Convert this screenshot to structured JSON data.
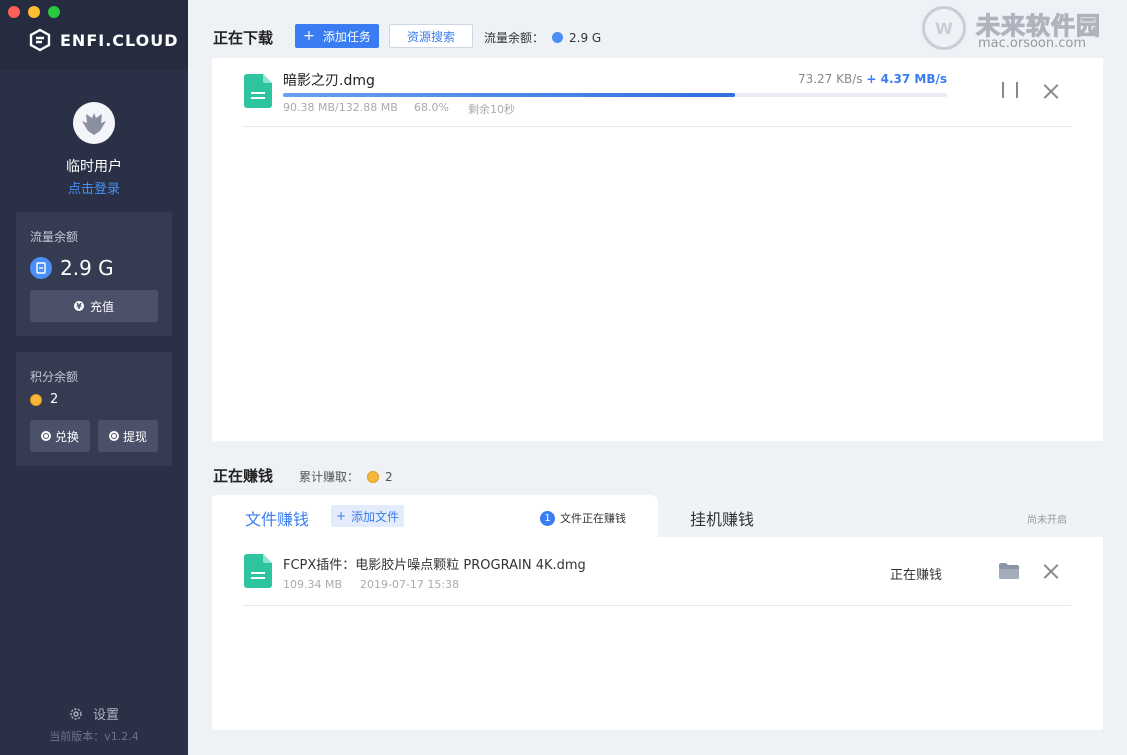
{
  "app": {
    "logo_text": "ENFI.CLOUD",
    "version": "当前版本：v1.2.4",
    "settings_label": "设置"
  },
  "user": {
    "name": "临时用户",
    "login_link": "点击登录"
  },
  "traffic_card": {
    "title": "流量余额",
    "value": "2.9 G",
    "recharge_label": "充值"
  },
  "points_card": {
    "title": "积分余额",
    "value": "2",
    "exchange_label": "兑换",
    "withdraw_label": "提现"
  },
  "downloading": {
    "title": "正在下载",
    "add_task_label": "添加任务",
    "search_label": "资源搜索",
    "quota_label": "流量余额：",
    "quota_value": "2.9 G",
    "items": [
      {
        "name": "暗影之刃.dmg",
        "speed": "73.27 KB/s",
        "boost": "+ 4.37 MB/s",
        "size": "90.38 MB/132.88 MB",
        "percent": "68.0%",
        "remaining": "剩余10秒",
        "progress": 0.68
      }
    ]
  },
  "earning": {
    "title": "正在赚钱",
    "total_label": "累计赚取：",
    "total_value": "2",
    "tab_file": "文件赚钱",
    "add_file_label": "添加文件",
    "earning_count": "1",
    "earning_count_label": "文件正在赚钱",
    "tab_idle": "挂机赚钱",
    "idle_status": "尚未开启",
    "items": [
      {
        "name": "FCPX插件：电影胶片噪点颗粒 PROGRAIN 4K.dmg",
        "size": "109.34 MB",
        "date": "2019-07-17 15:38",
        "status": "正在赚钱"
      }
    ]
  },
  "watermark": {
    "brand": "未来软件园",
    "url": "mac.orsoon.com"
  },
  "colors": {
    "sidebar": "#2a3146",
    "accent": "#3a7df2",
    "file_icon": "#2ec4a0",
    "coin": "#f3b73e"
  }
}
